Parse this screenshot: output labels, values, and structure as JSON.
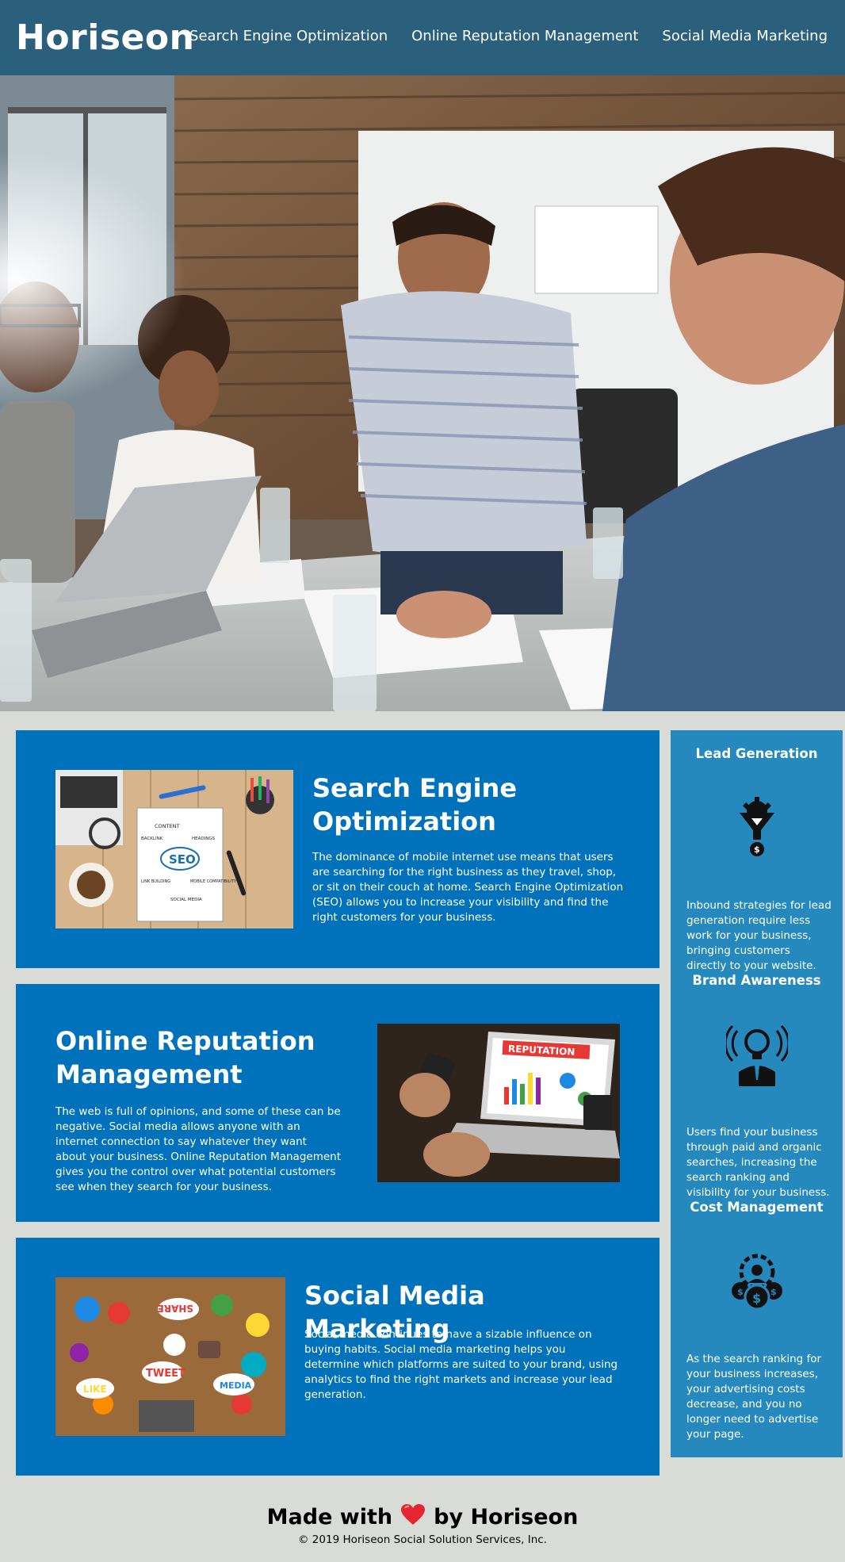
{
  "header": {
    "logo": "Horiseon",
    "nav": [
      "Search Engine Optimization",
      "Online Reputation Management",
      "Social Media Marketing"
    ]
  },
  "cards": [
    {
      "title": "Search Engine Optimization",
      "text": "The dominance of mobile internet use means that users are searching for the right business as they travel, shop, or sit on their couch at home. Search Engine Optimization (SEO) allows you to increase your visibility and find the right customers for your business.",
      "image_labels": [
        "CONTENT",
        "BACKLINK",
        "HEADINGS",
        "SEO",
        "LINK BUILDING",
        "MOBILE COMPATIBILITY",
        "SOCIAL MEDIA"
      ]
    },
    {
      "title": "Online Reputation Management",
      "text": "The web is full of opinions, and some of these can be negative. Social media allows anyone with an internet connection to say whatever they want about your business. Online Reputation Management gives you the control over what potential customers see when they search for your business.",
      "image_label": "REPUTATION"
    },
    {
      "title": "Social Media Marketing",
      "text": "Social media continues to have a sizable influence on buying habits. Social media marketing helps you determine which platforms are suited to your brand, using analytics to find the right markets and increase your lead generation.",
      "image_labels": [
        "SHARE",
        "TWEET",
        "LIKE",
        "MEDIA"
      ]
    }
  ],
  "sidebar": [
    {
      "title": "Lead Generation",
      "icon": "lead-funnel-icon",
      "text": "Inbound strategies for lead generation require less work for your business, bringing customers directly to your website."
    },
    {
      "title": "Brand Awareness",
      "icon": "brand-lightbulb-icon",
      "text": "Users find your business through paid and organic searches, increasing the search ranking and visibility for your business."
    },
    {
      "title": "Cost Management",
      "icon": "cost-gear-coins-icon",
      "text": "As the search ranking for your business increases, your advertising costs decrease, and you no longer need to advertise your page."
    }
  ],
  "footer": {
    "made_prefix": "Made with",
    "made_suffix": "by Horiseon",
    "copyright": "© 2019 Horiseon Social Solution Services, Inc."
  },
  "colors": {
    "header_bg": "#2a607c",
    "card_bg": "#0072bb",
    "sidebar_bg": "#2589bd",
    "page_bg": "#d9dcd6",
    "heart": "#e3262f"
  }
}
